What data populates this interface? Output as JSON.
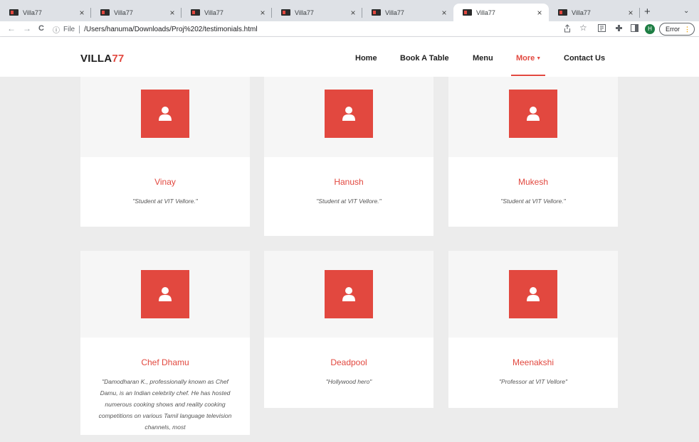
{
  "browser": {
    "tabs": [
      {
        "title": "Villa77"
      },
      {
        "title": "Villa77"
      },
      {
        "title": "Villa77"
      },
      {
        "title": "Villa77"
      },
      {
        "title": "Villa77"
      },
      {
        "title": "Villa77"
      },
      {
        "title": "Villa77"
      }
    ],
    "active_tab_index": 5,
    "close_glyph": "×",
    "new_tab_glyph": "+",
    "tab_menu_glyph": "⌄",
    "back_glyph": "←",
    "forward_glyph": "→",
    "reload_glyph": "C",
    "info_glyph": "ⓘ",
    "file_label": "File",
    "url": "/Users/hanuma/Downloads/Proj%202/testimonials.html",
    "profile_initial": "H",
    "error_label": "Error",
    "error_dots": "⋮",
    "icons": [
      "share-icon",
      "star-icon",
      "reader-icon",
      "extensions-icon",
      "sidepanel-icon"
    ]
  },
  "site": {
    "logo_main": "VILLA",
    "logo_accent": "77",
    "nav": [
      {
        "label": "Home"
      },
      {
        "label": "Book A Table"
      },
      {
        "label": "Menu"
      },
      {
        "label": "More"
      },
      {
        "label": "Contact Us"
      }
    ],
    "active_nav": "More",
    "accent_color": "#e2483f"
  },
  "testimonials": [
    {
      "name": "Vinay",
      "quote": "\"Student at VIT Vellore.\""
    },
    {
      "name": "Hanush",
      "quote": "\"Student at VIT Vellore.\""
    },
    {
      "name": "Mukesh",
      "quote": "\"Student at VIT Vellore.\""
    },
    {
      "name": "Chef Dhamu",
      "quote": "\"Damodharan K., professionally known as Chef Damu, is an Indian celebrity chef. He has hosted numerous cooking shows and reality cooking competitions on various Tamil language television channels, most"
    },
    {
      "name": "Deadpool",
      "quote": "\"Hollywood hero\""
    },
    {
      "name": "Meenakshi",
      "quote": "\"Professor at VIT Vellore\""
    }
  ]
}
